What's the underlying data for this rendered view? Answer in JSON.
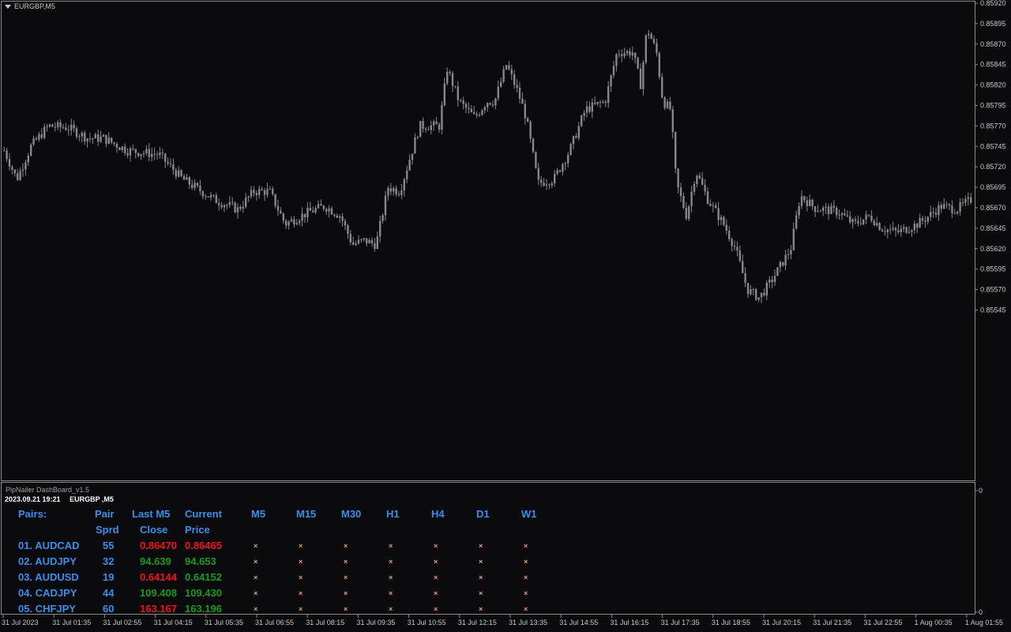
{
  "chart": {
    "symbol_label": "EURGBP,M5",
    "price_ticks": [
      "0.85920",
      "0.85895",
      "0.85870",
      "0.85845",
      "0.85820",
      "0.85795",
      "0.85770",
      "0.85745",
      "0.85720",
      "0.85695",
      "0.85670",
      "0.85645",
      "0.85620",
      "0.85595",
      "0.85570",
      "0.85545"
    ],
    "time_ticks": [
      "31 Jul 2023",
      "31 Jul 01:35",
      "31 Jul 02:55",
      "31 Jul 04:15",
      "31 Jul 05:35",
      "31 Jul 06:55",
      "31 Jul 08:15",
      "31 Jul 09:35",
      "31 Jul 10:55",
      "31 Jul 12:15",
      "31 Jul 13:35",
      "31 Jul 14:55",
      "31 Jul 16:15",
      "31 Jul 17:35",
      "31 Jul 18:55",
      "31 Jul 20:15",
      "31 Jul 21:35",
      "31 Jul 22:55",
      "1 Aug 00:35",
      "1 Aug 01:55"
    ],
    "indicator_scale": [
      "0",
      "0"
    ],
    "candle_color": "#888888",
    "background": "#0a0a0f"
  },
  "dashboard": {
    "title": "PipNailer DashBoard_v1.5",
    "datetime": "2023.09.21 19:21",
    "symbol": "EURGBP ,M5",
    "headers": {
      "pairs": "Pairs:",
      "pair_top": "Pair",
      "pair_bottom": "Sprd",
      "last_top": "Last M5",
      "last_bottom": "Close",
      "current_top": "Current",
      "current_bottom": "Price",
      "timeframes": [
        "M5",
        "M15",
        "M30",
        "H1",
        "H4",
        "D1",
        "W1"
      ]
    },
    "mark_symbol": "×",
    "rows": [
      {
        "pair": "01. AUDCAD",
        "spread": "55",
        "last": "0.86470",
        "last_dir": "red",
        "current": "0.86465",
        "current_dir": "red"
      },
      {
        "pair": "02. AUDJPY",
        "spread": "32",
        "last": "94.639",
        "last_dir": "green",
        "current": "94.653",
        "current_dir": "green"
      },
      {
        "pair": "03. AUDUSD",
        "spread": "19",
        "last": "0.64144",
        "last_dir": "red",
        "current": "0.64152",
        "current_dir": "green"
      },
      {
        "pair": "04. CADJPY",
        "spread": "44",
        "last": "109.408",
        "last_dir": "green",
        "current": "109.430",
        "current_dir": "green"
      },
      {
        "pair": "05. CHFJPY",
        "spread": "60",
        "last": "163.167",
        "last_dir": "red",
        "current": "163.196",
        "current_dir": "green"
      }
    ]
  }
}
